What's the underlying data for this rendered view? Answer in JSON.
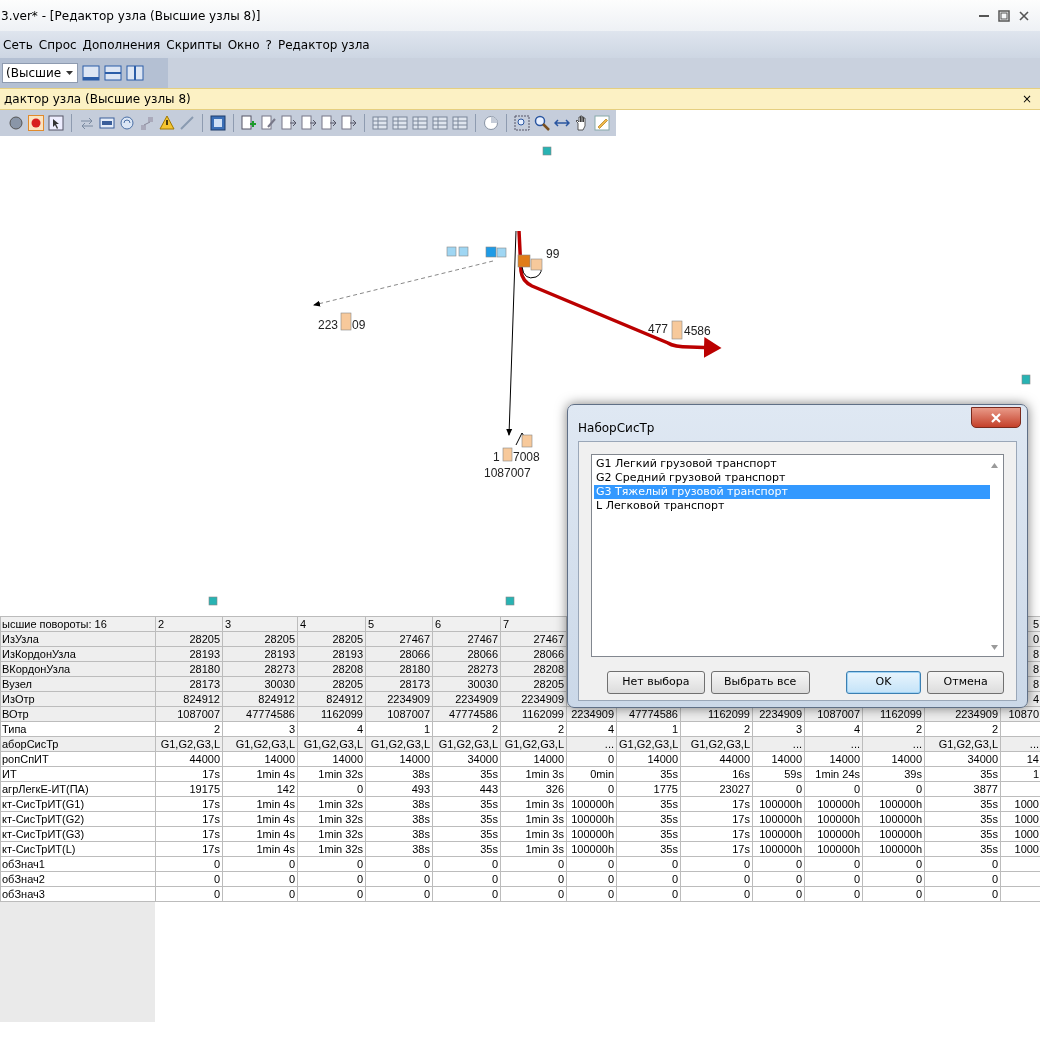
{
  "window": {
    "title": "3.ver* - [Редактор узла (Высшие узлы 8)]"
  },
  "menu": [
    "Сеть",
    "Спрос",
    "Дополнения",
    "Скрипты",
    "Окно",
    "?",
    "Редактор узла"
  ],
  "view_select": {
    "value": "(Высшие"
  },
  "doc_tab": {
    "title": "дактор узла (Высшие узлы 8)",
    "close": "×"
  },
  "diagram": {
    "labels": [
      "223",
      "09",
      "477",
      "4586",
      "1",
      "7008",
      "1087007",
      "99"
    ]
  },
  "table": {
    "header": {
      "label": "ысшие повороты: 16",
      "cells": [
        "2",
        "3",
        "4",
        "5",
        "6",
        "7"
      ],
      "edge": "5"
    },
    "rows": [
      {
        "label": "ИзУзла",
        "editable": false,
        "cells": [
          "28205",
          "28205",
          "28205",
          "27467",
          "27467",
          "27467"
        ],
        "edge": "0"
      },
      {
        "label": "ИзКордонУзла",
        "editable": false,
        "cells": [
          "28193",
          "28193",
          "28193",
          "28066",
          "28066",
          "28066"
        ],
        "edge": "8"
      },
      {
        "label": "ВКордонУзла",
        "editable": false,
        "cells": [
          "28180",
          "28273",
          "28208",
          "28180",
          "28273",
          "28208"
        ],
        "edge": "8"
      },
      {
        "label": "Вузел",
        "editable": false,
        "cells": [
          "28173",
          "30030",
          "28205",
          "28173",
          "30030",
          "28205"
        ],
        "edge": "8"
      },
      {
        "label": "ИзОтр",
        "editable": false,
        "cells": [
          "824912",
          "824912",
          "824912",
          "2234909",
          "2234909",
          "2234909"
        ],
        "edge": "4"
      },
      {
        "label": "ВОтр",
        "editable": false,
        "cells": [
          "1087007",
          "47774586",
          "1162099",
          "1087007",
          "47774586",
          "1162099",
          "2234909",
          "47774586",
          "1162099",
          "2234909",
          "1087007",
          "1162099",
          "2234909"
        ],
        "edge": "10870"
      },
      {
        "label": "Типа",
        "editable": true,
        "cells": [
          "2",
          "3",
          "4",
          "1",
          "2",
          "2",
          "4",
          "1",
          "2",
          "3",
          "4",
          "2",
          "2"
        ]
      },
      {
        "label": "аборСисТр",
        "editable": false,
        "cells": [
          "G1,G2,G3,L",
          "G1,G2,G3,L",
          "G1,G2,G3,L",
          "G1,G2,G3,L",
          "G1,G2,G3,L",
          "G1,G2,G3,L",
          "...",
          "G1,G2,G3,L",
          "G1,G2,G3,L",
          "...",
          "...",
          "...",
          "G1,G2,G3,L"
        ],
        "edge": "..."
      },
      {
        "label": "ропСпИТ",
        "editable": true,
        "cells": [
          "44000",
          "14000",
          "14000",
          "14000",
          "34000",
          "14000",
          "0",
          "14000",
          "44000",
          "14000",
          "14000",
          "14000",
          "34000"
        ],
        "edge": "14"
      },
      {
        "label": "ИТ",
        "editable": true,
        "cells": [
          "17s",
          "1min 4s",
          "1min 32s",
          "38s",
          "35s",
          "1min 3s",
          "0min",
          "35s",
          "16s",
          "59s",
          "1min 24s",
          "39s",
          "35s"
        ],
        "edge": "1"
      },
      {
        "label": "агрЛегкЕ-ИТ(ПА)",
        "editable": true,
        "cells": [
          "19175",
          "142",
          "0",
          "493",
          "443",
          "326",
          "0",
          "1775",
          "23027",
          "0",
          "0",
          "0",
          "3877"
        ]
      },
      {
        "label": "кт-СисТрИТ(G1)",
        "editable": true,
        "cells": [
          "17s",
          "1min 4s",
          "1min 32s",
          "38s",
          "35s",
          "1min 3s",
          "100000h",
          "35s",
          "17s",
          "100000h",
          "100000h",
          "100000h",
          "35s"
        ],
        "edge": "1000"
      },
      {
        "label": "кт-СисТрИТ(G2)",
        "editable": true,
        "cells": [
          "17s",
          "1min 4s",
          "1min 32s",
          "38s",
          "35s",
          "1min 3s",
          "100000h",
          "35s",
          "17s",
          "100000h",
          "100000h",
          "100000h",
          "35s"
        ],
        "edge": "1000"
      },
      {
        "label": "кт-СисТрИТ(G3)",
        "editable": true,
        "cells": [
          "17s",
          "1min 4s",
          "1min 32s",
          "38s",
          "35s",
          "1min 3s",
          "100000h",
          "35s",
          "17s",
          "100000h",
          "100000h",
          "100000h",
          "35s"
        ],
        "edge": "1000"
      },
      {
        "label": "кт-СисТрИТ(L)",
        "editable": true,
        "cells": [
          "17s",
          "1min 4s",
          "1min 32s",
          "38s",
          "35s",
          "1min 3s",
          "100000h",
          "35s",
          "17s",
          "100000h",
          "100000h",
          "100000h",
          "35s"
        ],
        "edge": "1000"
      },
      {
        "label": "обЗнач1",
        "editable": true,
        "cells": [
          "0",
          "0",
          "0",
          "0",
          "0",
          "0",
          "0",
          "0",
          "0",
          "0",
          "0",
          "0",
          "0"
        ]
      },
      {
        "label": "обЗнач2",
        "editable": true,
        "cells": [
          "0",
          "0",
          "0",
          "0",
          "0",
          "0",
          "0",
          "0",
          "0",
          "0",
          "0",
          "0",
          "0"
        ]
      },
      {
        "label": "обЗнач3",
        "editable": true,
        "cells": [
          "0",
          "0",
          "0",
          "0",
          "0",
          "0",
          "0",
          "0",
          "0",
          "0",
          "0",
          "0",
          "0"
        ]
      }
    ]
  },
  "dialog": {
    "title": "НаборСисТр",
    "items": [
      {
        "label": "G1 Легкий грузовой транспорт",
        "selected": false
      },
      {
        "label": "G2 Средний грузовой транспорт",
        "selected": false
      },
      {
        "label": "G3 Тяжелый грузовой транспорт",
        "selected": true
      },
      {
        "label": "L Легковой транспорт",
        "selected": false
      }
    ],
    "buttons": [
      {
        "label": "Нет выбора",
        "default": false
      },
      {
        "label": "Выбрать все",
        "default": false
      },
      {
        "label": "OK",
        "default": true
      },
      {
        "label": "Отмена",
        "default": false
      }
    ]
  }
}
